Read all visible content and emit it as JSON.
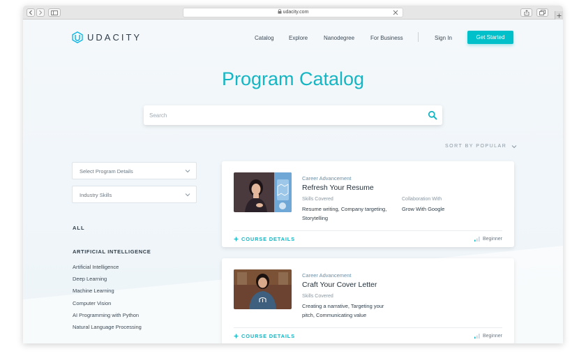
{
  "browser": {
    "url": "udacity.com"
  },
  "nav": {
    "brand": "UDACITY",
    "items": [
      "Catalog",
      "Explore",
      "Nanodegree",
      "For Business"
    ],
    "sign_in": "Sign In",
    "cta": "Get Started"
  },
  "page_title": "Program Catalog",
  "search": {
    "placeholder": "Search",
    "value": ""
  },
  "sort": {
    "label": "SORT BY POPULAR"
  },
  "filters": {
    "program_details": "Select Program Details",
    "industry_skills": "Industry Skills"
  },
  "categories": {
    "all": "ALL",
    "section_title": "ARTIFICIAL INTELLIGENCE",
    "items": [
      "Artificial Intelligence",
      "Deep Learning",
      "Machine Learning",
      "Computer Vision",
      "AI Programming with Python",
      "Natural Language Processing"
    ]
  },
  "cards": [
    {
      "category": "Career Advancement",
      "title": "Refresh Your Resume",
      "skills_label": "Skills Covered",
      "skills_line1": "Resume writing, Company targeting,",
      "skills_line2": "Storytelling",
      "collab_label": "Collaboration With",
      "collab_value": "Grow With Google",
      "details": "COURSE DETAILS",
      "level": "Beginner"
    },
    {
      "category": "Career Advancement",
      "title": "Craft Your Cover Letter",
      "skills_label": "Skills Covered",
      "skills_line1": "Creating a narrative, Targeting your",
      "skills_line2": "pitch, Communicating value",
      "details": "COURSE DETAILS",
      "level": "Beginner"
    }
  ],
  "colors": {
    "accent": "#02c0c9",
    "title": "#15b6c4",
    "text": "#2e3d49"
  }
}
